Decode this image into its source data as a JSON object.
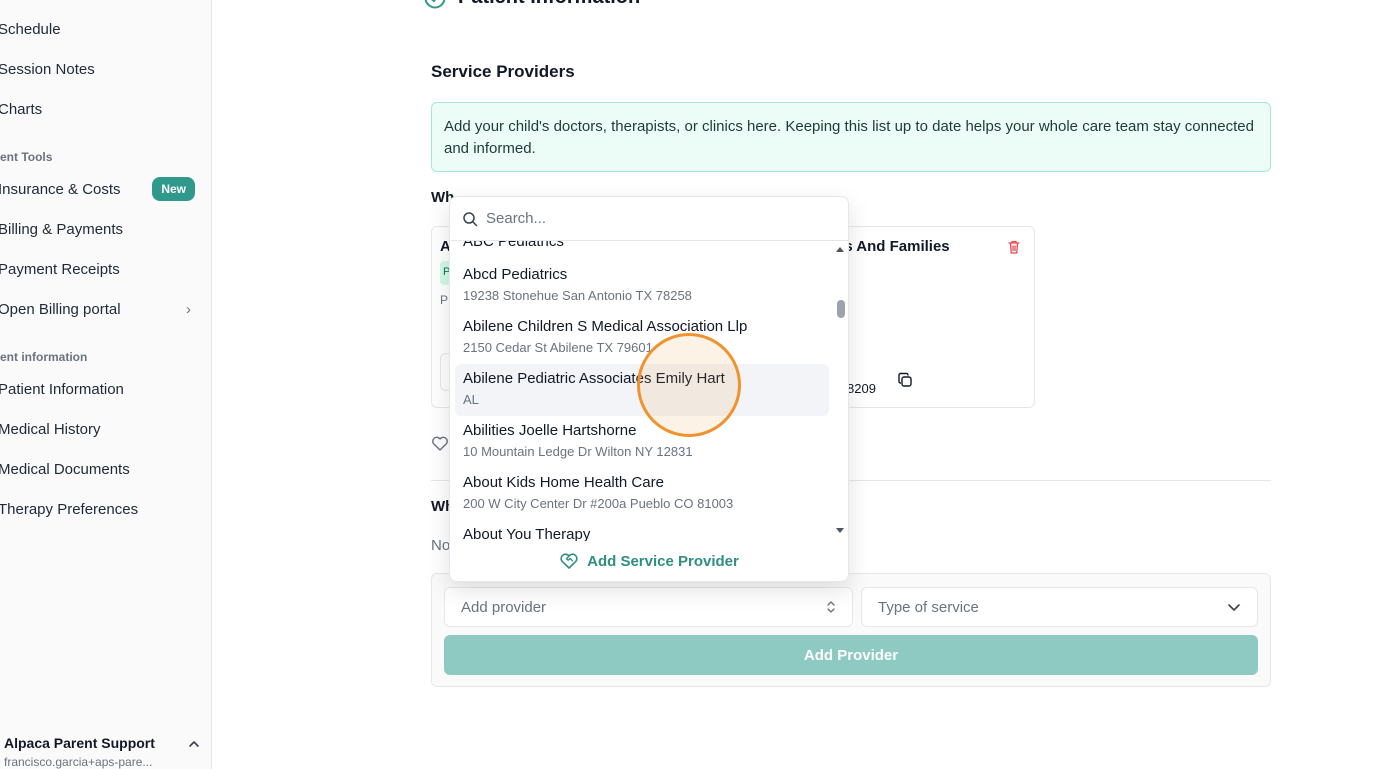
{
  "sidebar": {
    "sections": [
      {
        "label": "ent Tools"
      },
      {
        "label": "ent information"
      }
    ],
    "items": [
      {
        "label": "Schedule"
      },
      {
        "label": "Session Notes"
      },
      {
        "label": "Charts"
      },
      {
        "label": "Insurance & Costs",
        "badge": "New"
      },
      {
        "label": "Billing & Payments"
      },
      {
        "label": "Payment Receipts"
      },
      {
        "label": "Open Billing portal"
      },
      {
        "label": "Patient Information"
      },
      {
        "label": "Medical History"
      },
      {
        "label": "Medical Documents"
      },
      {
        "label": "Therapy Preferences"
      }
    ],
    "user": {
      "name": "Alpaca Parent Support",
      "email": "francisco.garcia+aps-pare..."
    }
  },
  "header": {
    "title": "Patient Information"
  },
  "providers": {
    "section_title": "Service Providers",
    "info_text": "Add your child's doctors, therapists, or clinics here. Keeping this list up to date helps your whole care team stay connected and informed.",
    "question_fragment": "Wh",
    "card_left": {
      "title_fragment": "A",
      "chip_fragment": "P",
      "text_fragment": "P"
    },
    "card_right": {
      "name_fragment": "ids And Families",
      "phone_fragment": "8209"
    },
    "other_heading_fragment": "Wh",
    "empty_fragment": "No"
  },
  "add_form": {
    "provider_placeholder": "Add provider",
    "service_placeholder": "Type of service",
    "add_button": "Add Provider"
  },
  "dropdown": {
    "search_placeholder": "Search...",
    "items": [
      {
        "name": "ABC Pediatrics",
        "address": ""
      },
      {
        "name": "Abcd Pediatrics",
        "address": "19238 Stonehue San Antonio TX 78258"
      },
      {
        "name": "Abilene Children S Medical Association Llp",
        "address": "2150 Cedar St Abilene TX 79601"
      },
      {
        "name": "Abilene Pediatric Associates Emily Hart",
        "address": "AL"
      },
      {
        "name": "Abilities Joelle Hartshorne",
        "address": "10 Mountain Ledge Dr Wilton NY 12831"
      },
      {
        "name": "About Kids Home Health Care",
        "address": "200 W City Center Dr #200a Pueblo CO 81003"
      },
      {
        "name": "About You Therapy",
        "address": ""
      }
    ],
    "footer_action": "Add Service Provider"
  },
  "colors": {
    "accent": "#2f9a8c",
    "info_bg": "#ecfdf7",
    "button_disabled": "#8ecac2",
    "cursor": "#f0932f"
  }
}
